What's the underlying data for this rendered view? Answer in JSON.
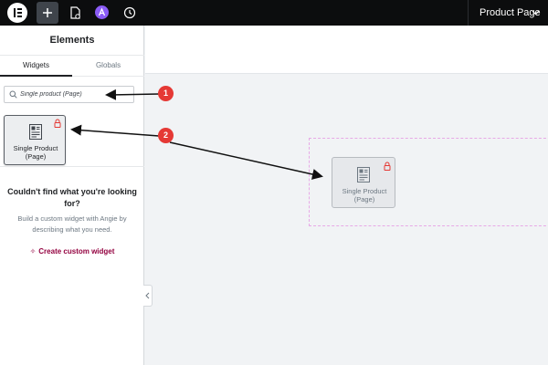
{
  "topbar": {
    "page_label": "Product Page"
  },
  "sidebar": {
    "title": "Elements",
    "tabs": [
      {
        "label": "Widgets"
      },
      {
        "label": "Globals"
      }
    ],
    "search": {
      "value": "Single product (Page)"
    },
    "widget": {
      "label_line1": "Single Product",
      "label_line2": "(Page)"
    },
    "not_found": {
      "title_line1": "Couldn't find what you're looking",
      "title_line2": "for?",
      "desc_line1": "Build a custom widget with Angie by",
      "desc_line2": "describing what you need.",
      "link_label": "Create custom widget"
    }
  },
  "canvas": {
    "widget": {
      "label_line1": "Single Product",
      "label_line2": "(Page)"
    }
  },
  "annotations": {
    "badges": [
      "1",
      "2"
    ]
  },
  "colors": {
    "topbar_bg": "#0c0d0e",
    "accent_link": "#93003f",
    "badge_red": "#e53935",
    "drop_zone_border": "#e7a9e6",
    "angie_purple": "#8b5cf6"
  },
  "icons": [
    "elementor-logo-icon",
    "plus-icon",
    "page-settings-icon",
    "angie-icon",
    "history-icon",
    "chevron-down-icon",
    "search-icon",
    "widget-product-icon",
    "lock-icon",
    "sparkle-icon",
    "chevron-left-icon"
  ]
}
